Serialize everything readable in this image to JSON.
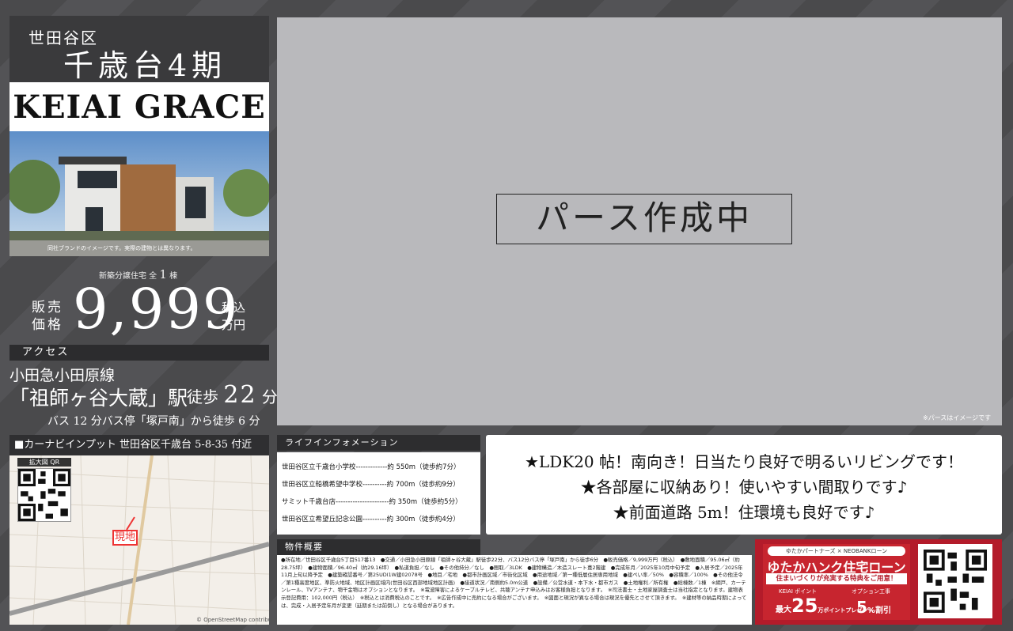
{
  "header": {
    "area": "世田谷区",
    "series": "千歳台4期",
    "brand": "KEIAI GRACE"
  },
  "photo_caption": "同社ブランドのイメージです。実際の建物とは異なります。",
  "sales": {
    "units_prefix": "新築分譲住宅 全",
    "units_count": "1",
    "units_suffix": "棟",
    "price_label_1": "販売",
    "price_label_2": "価格",
    "price": "9,999",
    "tax_1": "税込",
    "tax_2": "万円"
  },
  "access": {
    "header": "アクセス",
    "line": "小田急小田原線",
    "station": "「祖師ヶ谷大蔵」駅",
    "walk_label": "徒歩",
    "walk_min": "22",
    "walk_unit": "分",
    "bus": "バス 12 分バス停「塚戸南」から徒歩 6 分"
  },
  "map": {
    "header": "■カーナビインプット 世田谷区千歳台 5-8-35 付近",
    "qr_label": "拡大図 QR",
    "marker": "現地",
    "credit": "© OpenStreetMap contributors"
  },
  "render": {
    "placeholder": "パース作成中",
    "note": "※パースはイメージです"
  },
  "life_info": {
    "header": "ライフインフォメーション",
    "rows": [
      "世田谷区立千歳台小学校-------------約 550m（徒歩約7分）",
      "世田谷区立船橋希望中学校----------約 700m（徒歩約9分）",
      "サミット千歳台店----------------------約 350m（徒歩約5分）",
      "世田谷区立希望丘記念公園----------約 300m（徒歩約4分）"
    ]
  },
  "features": [
    "★LDK20 帖！南向き！日当たり良好で明るいリビングです！",
    "★各部屋に収納あり！使いやすい間取りです♪",
    "★前面道路 5m！住環境も良好です♪"
  ],
  "property": {
    "header": "物件概要",
    "text": "●所在地／世田谷区千歳台5丁目517番13　●交通／小田急小田原線「祖師ヶ谷大蔵」駅徒歩22分、バス12分バス停「塚戸南」から徒歩6分　●販売価格／9,999万円（税込）　●敷地面積／95.06㎡（約28.75坪）　●建物面積／96.40㎡（約29.16坪）　●私道負担／なし　●その他持分／なし　●間取／3LDK　●建物構造／木造スレート葺2階建　●完成年月／2025年10月中旬予定　●入居予定／2025年11月上旬以降予定　●建築確認番号／第25UDI1W建02078号　●地目／宅地　●都市計画区域／市街化区域　●用途地域／第一種低層住居専用地域　●建ぺい率／50%　●容積率／100%　●その他法令／第1種高度地区、準防火地域、地区計画区域内(世田谷区西部地域地区計画)　●接道状況／南側約5.0m公道　●設備／公営水道・本下水・都市ガス　●土地権利／所有権　●総棟数／1棟　※網戸、カーテンレール、TVアンテナ、物干金物はオプションとなります。　※電波障害によるケーブルテレビ、共聴アンテナ申込みはお客様負担となります。　※司法書士・土地家屋調査士は当社指定となります。建物表示登記費用：102,000円（税込）　※税込とは消費税込のことです。　※広告作成中に売約になる場合がございます。　※図面と現況が異なる場合は現況を優先とさせて頂きます。　※建材等の納品時期によっては、完成・入居予定年月が変更（延期または前倒し）となる場合があります。"
  },
  "banner": {
    "partner": "ゆたかパートナーズ × NEOBANKローン",
    "title": "ゆたかハンク住宅ローン",
    "sub": "住まいづくりが充実する特典をご用意！",
    "keiai_label": "KEIAI ポイント",
    "pt_prefix": "最大",
    "pt_value": "25",
    "pt_suffix": "万ポイントプレゼント",
    "opt_label": "オプション工事",
    "off_value": "5",
    "off_suffix": "%割引"
  }
}
